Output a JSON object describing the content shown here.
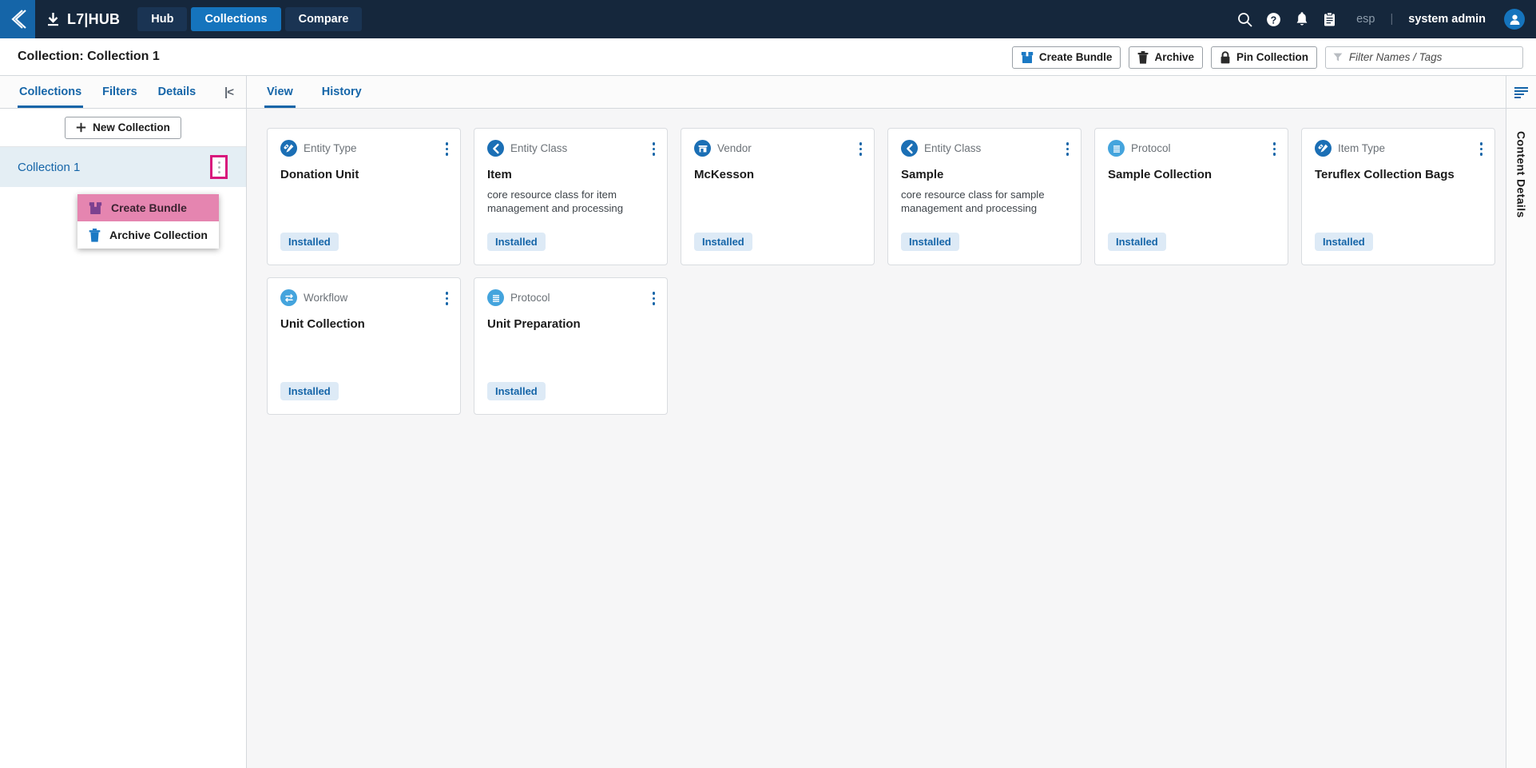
{
  "topnav": {
    "logo_icon": "chevron-left-logo-icon",
    "download_icon": "download-icon",
    "brand": "L7|HUB",
    "tabs": [
      {
        "label": "Hub",
        "active": false
      },
      {
        "label": "Collections",
        "active": true
      },
      {
        "label": "Compare",
        "active": false
      }
    ],
    "icons": [
      "search-icon",
      "help-icon",
      "notifications-icon",
      "clipboard-icon"
    ],
    "org": "esp",
    "separator": "|",
    "user": "system admin",
    "avatar_icon": "user-avatar-icon"
  },
  "subheader": {
    "title": "Collection: Collection 1",
    "buttons": [
      {
        "label": "Create Bundle",
        "icon": "bundle-box-icon"
      },
      {
        "label": "Archive",
        "icon": "trash-icon"
      },
      {
        "label": "Pin Collection",
        "icon": "lock-icon"
      }
    ],
    "filter": {
      "icon": "funnel-icon",
      "placeholder": "Filter Names / Tags",
      "value": ""
    }
  },
  "sidebar": {
    "tabs": [
      {
        "label": "Collections",
        "active": true
      },
      {
        "label": "Filters",
        "active": false
      },
      {
        "label": "Details",
        "active": false
      }
    ],
    "collapse_icon": "|<",
    "new_collection_label": "New Collection",
    "new_collection_icon": "plus-icon",
    "collections": [
      {
        "label": "Collection 1",
        "selected": true
      }
    ],
    "context_menu": [
      {
        "label": "Create Bundle",
        "icon": "bundle-box-icon",
        "highlighted": true
      },
      {
        "label": "Archive Collection",
        "icon": "trash-icon",
        "highlighted": false
      }
    ]
  },
  "main": {
    "tabs": [
      {
        "label": "View",
        "active": true
      },
      {
        "label": "History",
        "active": false
      }
    ],
    "cards": [
      {
        "type": "Entity Type",
        "icon": "test-tube-pencil-icon",
        "title": "Donation Unit",
        "description": "",
        "badge": "Installed"
      },
      {
        "type": "Entity Class",
        "icon": "chevron-left-circle-icon",
        "title": "Item",
        "description": "core resource class for item management and processing",
        "badge": "Installed"
      },
      {
        "type": "Vendor",
        "icon": "storefront-icon",
        "title": "McKesson",
        "description": "",
        "badge": "Installed"
      },
      {
        "type": "Entity Class",
        "icon": "chevron-left-circle-icon",
        "title": "Sample",
        "description": "core resource class for sample management and processing",
        "badge": "Installed"
      },
      {
        "type": "Protocol",
        "icon": "document-lines-icon",
        "title": "Sample Collection",
        "description": "",
        "badge": "Installed"
      },
      {
        "type": "Item Type",
        "icon": "test-tube-pencil-icon",
        "title": "Teruflex Collection Bags",
        "description": "",
        "badge": "Installed"
      },
      {
        "type": "Workflow",
        "icon": "workflow-arrows-icon",
        "title": "Unit Collection",
        "description": "",
        "badge": "Installed"
      },
      {
        "type": "Protocol",
        "icon": "document-lines-icon",
        "title": "Unit Preparation",
        "description": "",
        "badge": "Installed"
      }
    ]
  },
  "right_rail": {
    "icon": "content-details-lines-icon",
    "label": "Content Details"
  },
  "colors": {
    "nav_bg": "#15273c",
    "nav_logo_bg": "#1565a8",
    "accent_blue": "#1565a8",
    "tab_active_blue": "#1574bd",
    "highlight_magenta": "#d8177c",
    "menu_highlight_pink": "#e585b0",
    "badge_bg": "#ddeaf6",
    "selected_row_bg": "#e4eef4",
    "main_bg": "#f6f6f7"
  }
}
